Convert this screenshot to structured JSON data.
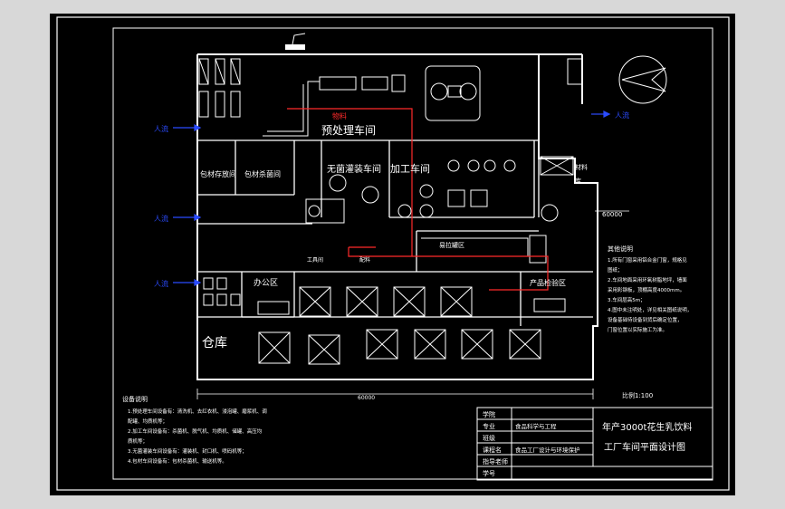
{
  "colors": {
    "background": "#000000",
    "lines": "#ffffff",
    "flow": "#ff2a2a",
    "airflow": "#2b4bff"
  },
  "rooms": {
    "pretreatment": "预处理车间",
    "material": "物料",
    "packaging_storage": "包材存放间",
    "packaging_prep": "包材杀菌间",
    "aseptic_filling": "无菌灌装车间",
    "processing": "加工车间",
    "office": "办公区",
    "warehouse": "仓库",
    "inspection": "产品检验区",
    "canning": "易拉罐区",
    "misc_right_top": "材料",
    "misc_right_room": "库",
    "small_label_1": "工具间",
    "small_label_2": "配料"
  },
  "airflow_labels": [
    "人流",
    "人流",
    "人流",
    "人流"
  ],
  "dimensions": {
    "right": "60000",
    "bottom": "60000"
  },
  "notes": {
    "title": "其他说明",
    "lines": [
      "1.所有门窗采用铝合金门窗，规格见",
      "  图纸；",
      "2.车间地面采用环氧树脂地坪，墙面",
      "  采用彩钢板，顶棚高度4000mm。",
      "3.车间层高5m；",
      "4.图中未注明处，详见相关图纸说明，",
      "  设备基础待设备到货后确定位置，",
      "  门窗位置以实际施工为准。"
    ]
  },
  "scale": "比例1:100",
  "equipment_notes": {
    "title": "设备说明",
    "lines": [
      "1.预处理车间设备有：清洗机、去红衣机、浸泡罐、磨浆机、调",
      "  配罐、均质机等；",
      "2.加工车间设备有：杀菌机、脱气机、均质机、储罐、高压均",
      "  质机等；",
      "3.无菌灌装车间设备有：灌装机、封口机、喷码机等；",
      "4.包材车间设备有：包材杀菌机、输送机等。"
    ]
  },
  "title_block": {
    "labels": [
      "学院",
      "专业",
      "班级",
      "课程名",
      "指导老师",
      "学号"
    ],
    "values": [
      "",
      "食品科学与工程",
      "",
      "食品工厂设计与环境保护",
      "",
      ""
    ],
    "title_line1": "年产3000t花生乳饮料",
    "title_line2": "工厂车间平面设计图"
  },
  "north": "N"
}
